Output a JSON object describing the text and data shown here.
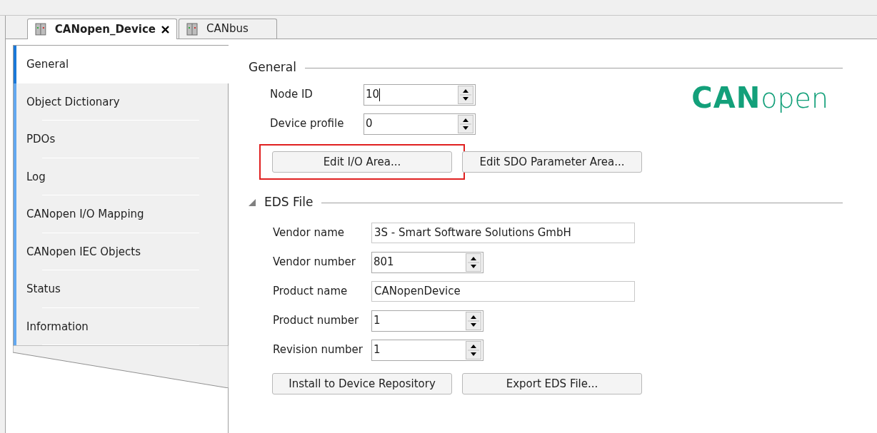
{
  "tabs": [
    {
      "label": "CANopen_Device",
      "selected": true,
      "closable": true
    },
    {
      "label": "CANbus",
      "selected": false,
      "closable": false
    }
  ],
  "sidebar": {
    "items": [
      {
        "label": "General",
        "selected": true
      },
      {
        "label": "Object Dictionary",
        "selected": false
      },
      {
        "label": "PDOs",
        "selected": false
      },
      {
        "label": "Log",
        "selected": false
      },
      {
        "label": "CANopen I/O Mapping",
        "selected": false
      },
      {
        "label": "CANopen IEC Objects",
        "selected": false
      },
      {
        "label": "Status",
        "selected": false
      },
      {
        "label": "Information",
        "selected": false
      }
    ]
  },
  "general": {
    "title": "General",
    "logo": {
      "bold": "CAN",
      "light": "open"
    },
    "fields": [
      {
        "label": "Node ID",
        "value": "10",
        "kind": "spin",
        "focused": true
      },
      {
        "label": "Device profile",
        "value": "0",
        "kind": "spin",
        "focused": false
      }
    ],
    "buttons": [
      {
        "label": "Edit I/O Area...",
        "highlighted": true
      },
      {
        "label": "Edit SDO Parameter Area...",
        "highlighted": false
      }
    ]
  },
  "eds_file": {
    "title": "EDS File",
    "expanded": true,
    "fields": [
      {
        "label": "Vendor name",
        "value": "3S - Smart Software Solutions GmbH",
        "kind": "text"
      },
      {
        "label": "Vendor number",
        "value": "801",
        "kind": "spin"
      },
      {
        "label": "Product name",
        "value": "CANopenDevice",
        "kind": "text"
      },
      {
        "label": "Product number",
        "value": "1",
        "kind": "spin"
      },
      {
        "label": "Revision number",
        "value": "1",
        "kind": "spin"
      }
    ],
    "buttons": [
      {
        "label": "Install to Device Repository"
      },
      {
        "label": "Export EDS File..."
      }
    ]
  }
}
